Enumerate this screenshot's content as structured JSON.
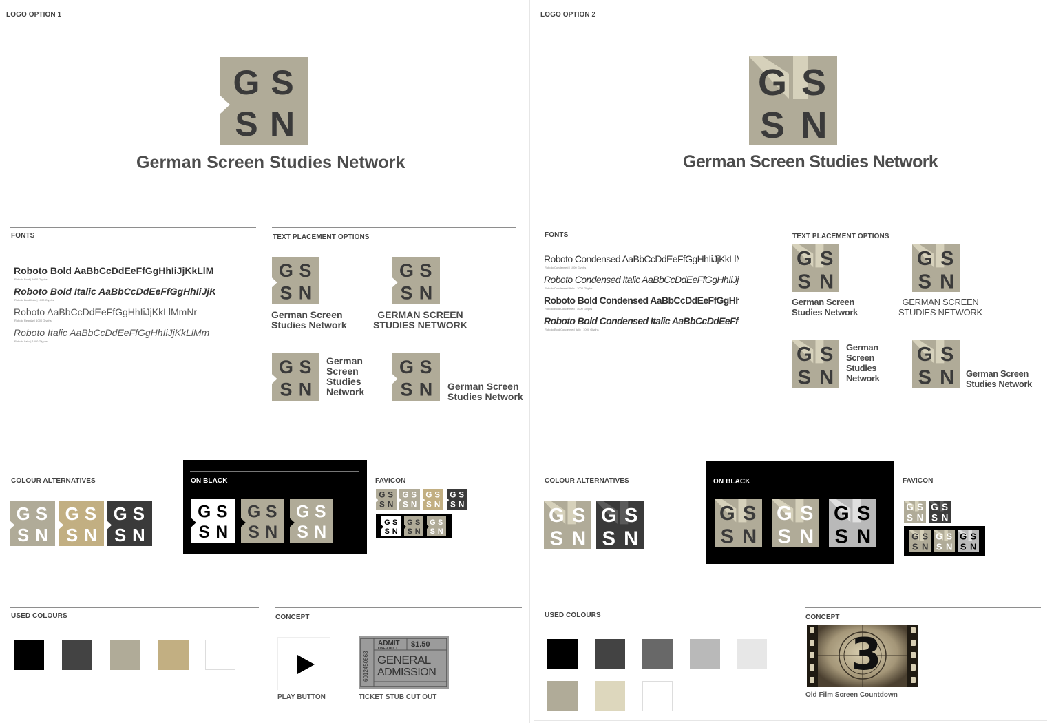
{
  "colors": {
    "black": "#000000",
    "dark_grey": "#434343",
    "warm_grey": "#b0ab98",
    "gold": "#c2af82",
    "white": "#ffffff",
    "mid_grey": "#686868",
    "light_grey": "#b9b9b9",
    "very_light_grey": "#e7e7e7",
    "cream": "#ddd7bd",
    "logo_text": "#3a3a3a"
  },
  "logo_letters": {
    "l1": "G",
    "l2": "S",
    "l3": "S",
    "l4": "N"
  },
  "left": {
    "title": "LOGO OPTION 1",
    "name": "German Screen Studies Network",
    "fonts_label": "FONTS",
    "fonts": [
      {
        "text": "Roboto Bold AaBbCcDdEeFfGgHhIiJjKkLlM",
        "sub": "Roboto Bold | 1000 Glyphs"
      },
      {
        "text": "Roboto Bold Italic AaBbCcDdEeFfGgHhIiJjKk",
        "sub": "Roboto Bold Italic | 1000 Glyphs"
      },
      {
        "text": "Roboto AaBbCcDdEeFfGgHhIiJjKkLlMmNr",
        "sub": "Roboto Regular | 1000 Glyphs"
      },
      {
        "text": "Roboto Italic AaBbCcDdEeFfGgHhIiJjKkLlMm",
        "sub": "Roboto Italic | 1000 Glyphs"
      }
    ],
    "text_placement_label": "TEXT PLACEMENT OPTIONS",
    "placements": [
      "German Screen\nStudies Network",
      "GERMAN SCREEN\nSTUDIES NETWORK",
      "German\nScreen\nStudies\nNetwork",
      "German Screen\nStudies Network"
    ],
    "colour_alternatives_label": "COLOUR ALTERNATIVES",
    "on_black_label": "ON BLACK",
    "favicon_label": "FAVICON",
    "used_colours_label": "USED COLOURS",
    "concept_label": "CONCEPT",
    "play_button_caption": "PLAY BUTTON",
    "ticket_caption": "TICKET STUB CUT OUT",
    "ticket": {
      "admit": "ADMIT",
      "one_adult": "ONE ADULT",
      "price": "$1.50",
      "general": "GENERAL",
      "admission": "ADMISSION",
      "serial": "6012450863"
    }
  },
  "right": {
    "title": "LOGO OPTION 2",
    "name": "German Screen Studies Network",
    "fonts_label": "FONTS",
    "fonts": [
      {
        "text": "Roboto Condensed AaBbCcDdEeFfGgHhIiJjKkLlM",
        "sub": "Roboto Condensed | 1000 Glyphs"
      },
      {
        "text": "Roboto Condensed Italic AaBbCcDdEeFfGgHhIiJjKk",
        "sub": "Roboto Condensed Italic | 1000 Glyphs"
      },
      {
        "text": "Roboto Bold Condensed AaBbCcDdEeFfGgHhIiJjK",
        "sub": "Roboto Bold Condensed | 1000 Glyphs"
      },
      {
        "text": "Roboto Bold Condensed Italic AaBbCcDdEeFfGgHh",
        "sub": "Roboto Bold Condensed Italic | 1000 Glyphs"
      }
    ],
    "text_placement_label": "TEXT PLACEMENT OPTIONS",
    "placements": [
      "German Screen\nStudies Network",
      "GERMAN SCREEN\nSTUDIES NETWORK",
      "German\nScreen\nStudies\nNetwork",
      "German Screen\nStudies Network"
    ],
    "colour_alternatives_label": "COLOUR ALTERNATIVES",
    "on_black_label": "ON BLACK",
    "favicon_label": "FAVICON",
    "used_colours_label": "USED COLOURS",
    "concept_label": "CONCEPT",
    "countdown_number": "3",
    "countdown_caption": "Old  Film Screen Countdown"
  }
}
